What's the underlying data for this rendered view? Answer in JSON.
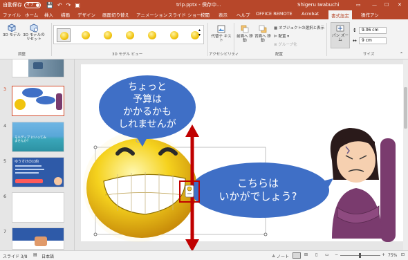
{
  "titlebar": {
    "autosave": "自動保存",
    "toggle": "オフ",
    "filename": "trip.pptx - 保存中...",
    "user": "Shigeru Iwabuchi"
  },
  "tabs": [
    "ファイル",
    "ホーム",
    "挿入",
    "描画",
    "デザイン",
    "画面切り替え",
    "アニメーション",
    "スライド ショー",
    "校閲",
    "表示",
    "ヘルプ",
    "OFFICE REMOTE",
    "Acrobat",
    "書式設定",
    "操作アシ"
  ],
  "ribbon": {
    "model3d": "3D モデル",
    "reset": "3D モデルの リセット",
    "group_adjust": "調整",
    "group_views": "3D モデル ビュー",
    "alt_text": "代替テ キスト",
    "group_accessibility": "アクセシビリティ",
    "bring_forward": "前面へ 移動",
    "send_backward": "背面へ 移動",
    "selection_pane": "オブジェクトの選択と表示",
    "align": "配置",
    "group": "グループ化",
    "group_arrange": "配置",
    "pan_zoom": "パン ズーム",
    "height": "9.06 cm",
    "width": "9 cm",
    "group_size": "サイズ"
  },
  "slides_panel": {
    "numbers": [
      "3",
      "4",
      "5",
      "6",
      "7"
    ],
    "thumb4_text": "モルディブ にいってみませんか?",
    "thumb5_title": "ゆうすけの公約"
  },
  "slide": {
    "bubble1": [
      "ちょっと",
      "予算は",
      "かかるかも",
      "しれませんが"
    ],
    "bubble2": [
      "こちらは",
      "いかがでしょう?"
    ]
  },
  "status": {
    "slide": "スライド 3/8",
    "lang": "日本語",
    "notes": "ノート",
    "zoom": "75%"
  },
  "colors": {
    "brand": "#b7472a",
    "bubble": "#3f6fc6",
    "arrow": "#c00000"
  }
}
